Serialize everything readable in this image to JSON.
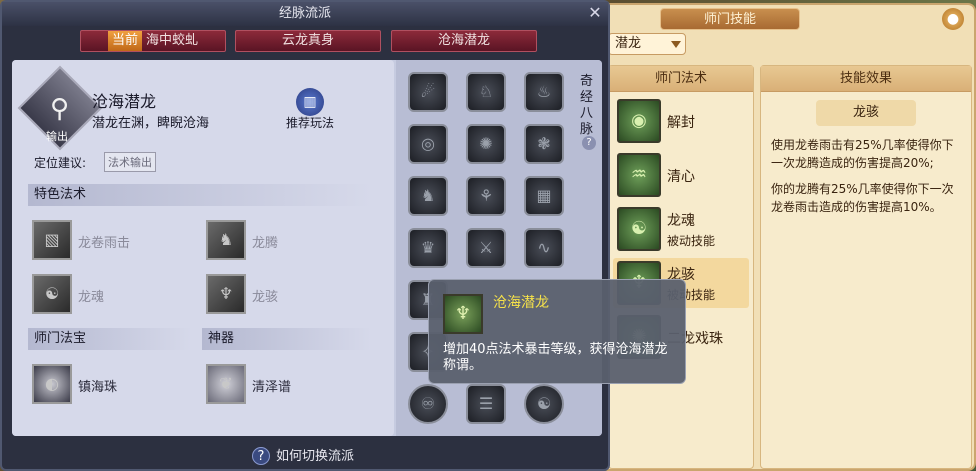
{
  "main_window": {
    "title": "经脉流派",
    "close_label": "✕",
    "tabs": [
      {
        "current_tag": "当前",
        "label": "海中蛟虬"
      },
      {
        "label": "云龙真身"
      },
      {
        "label": "沧海潜龙"
      }
    ]
  },
  "school": {
    "name": "沧海潜龙",
    "desc": "潜龙在渊，睥睨沧海",
    "role_tag": "输出",
    "guide_label": "推荐玩法",
    "position_label": "定位建议:",
    "position_value": "法术输出"
  },
  "sections": {
    "special_spells": "特色法术",
    "treasure": "师门法宝",
    "artifact": "神器"
  },
  "special_spells": [
    {
      "name": "龙卷雨击"
    },
    {
      "name": "龙腾"
    },
    {
      "name": "龙魂"
    },
    {
      "name": "龙骇"
    }
  ],
  "treasure": {
    "name": "镇海珠"
  },
  "artifact": {
    "name": "清泽谱"
  },
  "meridian": {
    "label": "奇经八脉",
    "help": "?"
  },
  "bottom_help": {
    "icon": "?",
    "label": "如何切换流派"
  },
  "tooltip": {
    "name": "沧海潜龙",
    "desc": "增加40点法术暴击等级，获得沧海潜龙称谓。"
  },
  "skill_window": {
    "title": "师门技能",
    "close_label": "●",
    "school_select": "潜龙",
    "col_spells": "师门法术",
    "col_effect": "技能效果",
    "skills": [
      {
        "name": "解封",
        "sub": ""
      },
      {
        "name": "清心",
        "sub": ""
      },
      {
        "name": "龙魂",
        "sub": "被动技能"
      },
      {
        "name": "龙骇",
        "sub": "被动技能"
      },
      {
        "name": "二龙戏珠",
        "sub": ""
      }
    ],
    "selected_skill": "龙骇",
    "effect_text_1": "使用龙卷雨击有25%几率使得你下一次龙腾造成的伤害提高20%;",
    "effect_text_2": "你的龙腾有25%几率使得你下一次龙卷雨击造成的伤害提高10%。"
  }
}
